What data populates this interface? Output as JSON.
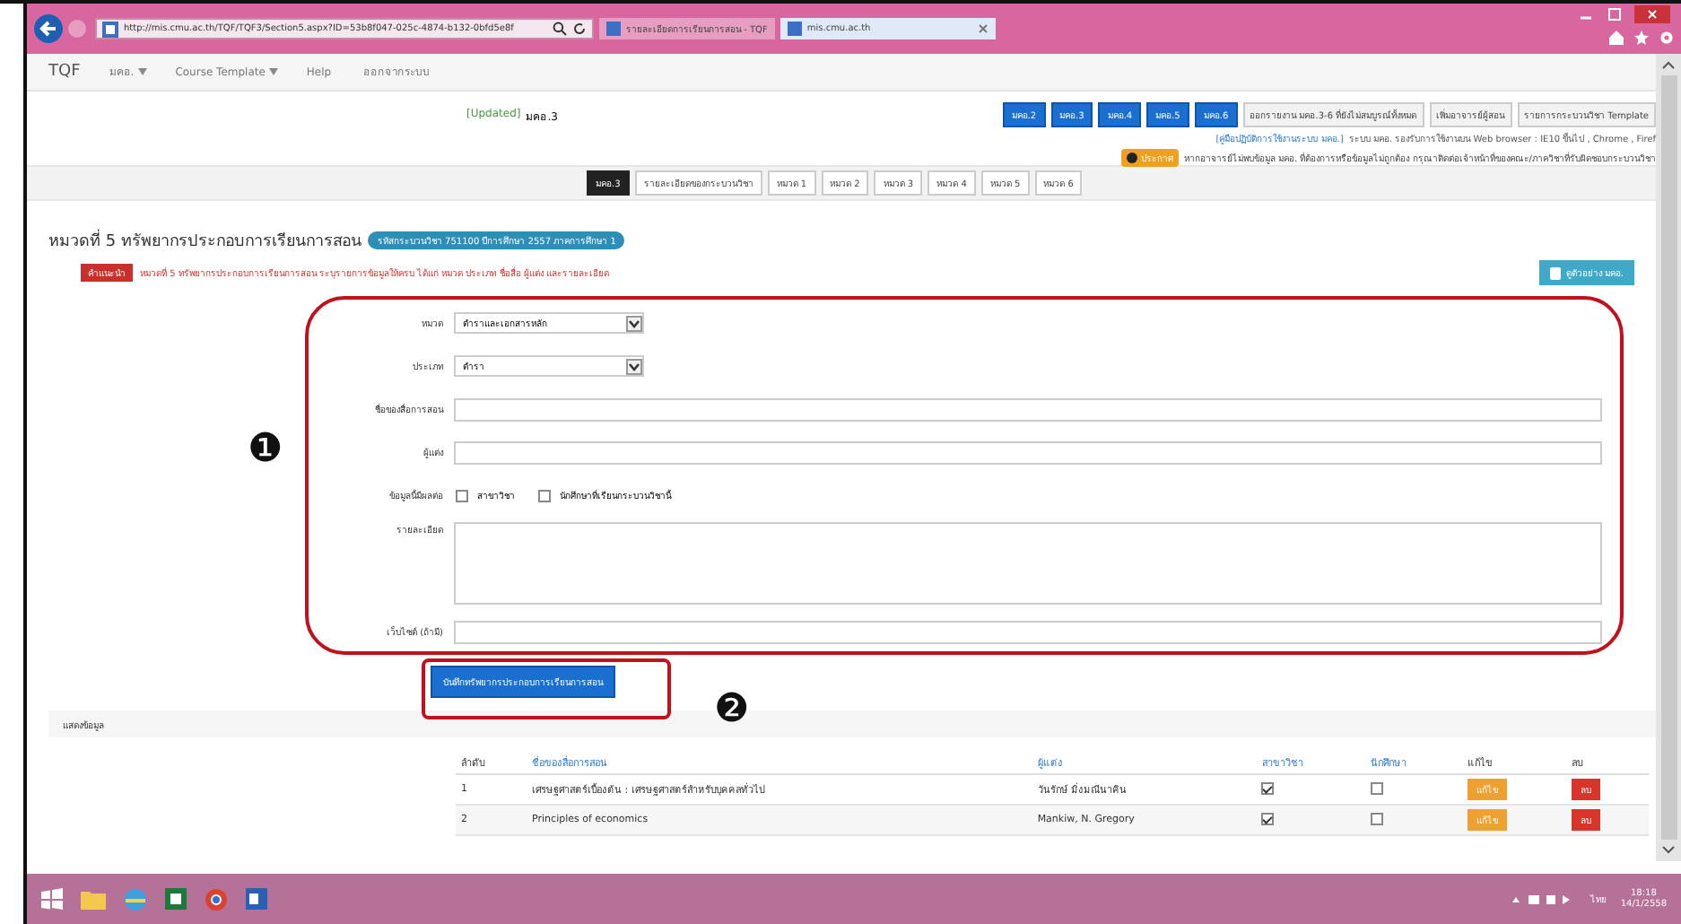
{
  "browser": {
    "address": "http://mis.cmu.ac.th/TQF/TQF3/Section5.aspx?ID=53b8f047-025c-4874-b132-0bfd5e8f",
    "tabs": [
      {
        "label": "รายละเอียดการเรียนการสอน - TQF",
        "selected": false
      },
      {
        "label": "mis.cmu.ac.th",
        "selected": true
      }
    ]
  },
  "nav": {
    "brand": "TQF",
    "items": [
      {
        "label": "มคอ.",
        "dropdown": true
      },
      {
        "label": "Course Template",
        "dropdown": true
      },
      {
        "label": "Help",
        "dropdown": false
      },
      {
        "label": "ออกจากระบบ",
        "dropdown": false
      }
    ]
  },
  "header": {
    "updated_tag": "[Updated]",
    "updated_text": "มคอ.3",
    "doc_buttons": [
      "มคอ.2",
      "มคอ.3",
      "มคอ.4",
      "มคอ.5",
      "มคอ.6"
    ],
    "action_buttons": [
      "ออกรายงาน มคอ.3-6 ที่ยังไม่สมบูรณ์ทั้งหมด",
      "เพิ่มอาจารย์ผู้สอน",
      "รายการกระบวนวิชา Template"
    ],
    "manual_link": "[คู่มือปฏิบัติการใช้งานระบบ มคอ.]",
    "manual_text": "ระบบ มคอ. รองรับการใช้งานบน Web browser : IE10 ขึ้นไป , Chrome , Firef",
    "notice_badge": "ประกาศ",
    "notice_text": "หากอาจารย์ไม่พบข้อมูล มคอ. ที่ต้องการหรือข้อมูลไม่ถูกต้อง กรุณาติดต่อเจ้าหน้าที่ของคณะ/ภาควิชาที่รับผิดชอบกระบวนวิชา"
  },
  "section_tabs": [
    {
      "label": "มคอ.3",
      "selected": true
    },
    {
      "label": "รายละเอียดของกระบวนวิชา",
      "selected": false
    },
    {
      "label": "หมวด 1",
      "selected": false
    },
    {
      "label": "หมวด 2",
      "selected": false
    },
    {
      "label": "หมวด 3",
      "selected": false
    },
    {
      "label": "หมวด 4",
      "selected": false
    },
    {
      "label": "หมวด 5",
      "selected": false
    },
    {
      "label": "หมวด 6",
      "selected": false
    }
  ],
  "page": {
    "title": "หมวดที่ 5 ทรัพยากรประกอบการเรียนการสอน",
    "course_badge": "รหัสกระบวนวิชา 751100 ปีการศึกษา 2557 ภาคการศึกษา 1",
    "hint_badge": "คำแนะนำ",
    "hint_text": "หมวดที่ 5 ทรัพยากรประกอบการเรียนการสอน ระบุรายการข้อมูลให้ครบ ได้แก่ หมวด ประเภท ชื่อสื่อ ผู้แต่ง และรายละเอียด",
    "example_button": "ดูตัวอย่าง มคอ."
  },
  "form": {
    "fields": [
      {
        "kind": "select",
        "label": "หมวด",
        "value": "ตำราและเอกสารหลัก"
      },
      {
        "kind": "select",
        "label": "ประเภท",
        "value": "ตำรา"
      },
      {
        "kind": "text",
        "label": "ชื่อของสื่อการสอน"
      },
      {
        "kind": "text",
        "label": "ผู้แต่ง"
      },
      {
        "kind": "checks",
        "label": "ข้อมูลนี้มีผลต่อ",
        "options": [
          {
            "label": "สาขาวิชา",
            "checked": false
          },
          {
            "label": "นักศึกษาที่เรียนกระบวนวิชานี้",
            "checked": false
          }
        ]
      },
      {
        "kind": "textarea",
        "label": "รายละเอียด"
      },
      {
        "kind": "text",
        "label": "เว็บไซต์ (ถ้ามี)"
      }
    ],
    "save_button": "บันทึกทรัพยากรประกอบการเรียนการสอน"
  },
  "annotations": [
    "❶",
    "❷"
  ],
  "results": {
    "title": "แสดงข้อมูล",
    "columns": [
      "ลำดับ",
      "ชื่อของสื่อการสอน",
      "ผู้แต่ง",
      "สาขาวิชา",
      "นักศึกษา",
      "แก้ไข",
      "ลบ"
    ],
    "rows": [
      {
        "no": "1",
        "name": "เศรษฐศาสตร์เบื้องต้น : เศรษฐศาสตร์สำหรับบุคคลทั่วไป",
        "author": "วันรักษ์ มิ่งมณีนาคิน",
        "major": true,
        "student": false,
        "edit": "แก้ไข",
        "delete": "ลบ"
      },
      {
        "no": "2",
        "name": "Principles of economics",
        "author": "Mankiw, N. Gregory",
        "major": true,
        "student": false,
        "edit": "แก้ไข",
        "delete": "ลบ"
      }
    ]
  },
  "taskbar": {
    "language": "ไทย",
    "time": "18:18",
    "date": "14/1/2558"
  }
}
